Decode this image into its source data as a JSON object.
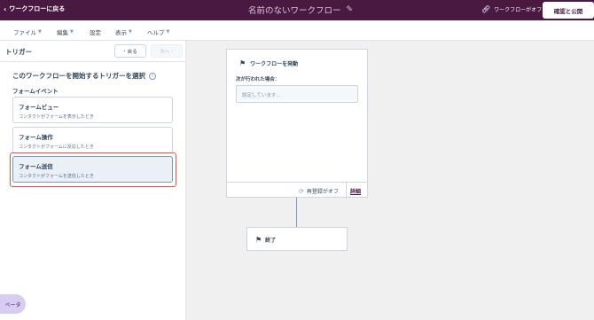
{
  "topbar": {
    "back_label": "ワークフローに戻る",
    "workflow_title": "名前のないワークフロー",
    "status_label": "ワークフローがオフ",
    "review_button": "確認と公開"
  },
  "menubar": {
    "items": [
      {
        "label": "ファイル",
        "has_caret": true
      },
      {
        "label": "編集",
        "has_caret": true
      },
      {
        "label": "設定",
        "has_caret": false
      },
      {
        "label": "表示",
        "has_caret": true
      },
      {
        "label": "ヘルプ",
        "has_caret": true
      }
    ]
  },
  "panel": {
    "title": "トリガー",
    "back_button": "戻る",
    "next_button": "次へ",
    "prompt": "このワークフローを開始するトリガーを選択",
    "section_label": "フォームイベント",
    "cards": [
      {
        "title": "フォームビュー",
        "desc": "コンタクトがフォームを表示したとき"
      },
      {
        "title": "フォーム操作",
        "desc": "コンタクトがフォームに反応したとき"
      },
      {
        "title": "フォーム送信",
        "desc": "コンタクトがフォームを送信したとき"
      }
    ]
  },
  "beta_label": "ベータ",
  "canvas": {
    "trigger_node": {
      "heading": "ワークフローを発動",
      "condition_label": "次が行われた場合：",
      "condition_placeholder": "設定しています...",
      "reenroll_label": "再登録がオフ",
      "details_link": "詳細"
    },
    "end_node": {
      "label": "終了"
    }
  },
  "colors": {
    "topbar": "#4a1942",
    "highlight": "#e8533f",
    "beta_bg": "#d9ccf2"
  }
}
